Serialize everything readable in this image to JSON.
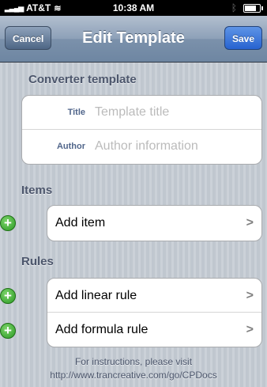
{
  "status_bar": {
    "carrier": "AT&T",
    "time": "10:38 AM",
    "battery_level": 0.8
  },
  "nav": {
    "title": "Edit Template",
    "cancel_label": "Cancel",
    "save_label": "Save"
  },
  "converter_section": {
    "header": "Converter template",
    "fields": [
      {
        "label": "Title",
        "value": "",
        "placeholder": "Template title"
      },
      {
        "label": "Author",
        "value": "",
        "placeholder": "Author information"
      }
    ]
  },
  "items_section": {
    "header": "Items",
    "rows": [
      {
        "label": "Add item"
      }
    ]
  },
  "rules_section": {
    "header": "Rules",
    "rows": [
      {
        "label": "Add linear rule"
      },
      {
        "label": "Add formula rule"
      }
    ]
  },
  "footer": {
    "line1": "For instructions, please visit",
    "line2": "http://www.trancreative.com/go/CPDocs"
  },
  "colors": {
    "background": "#c5ccd4",
    "nav_bar": "#6e86a2",
    "save_button": "#2763d0",
    "add_icon": "#2a9a23",
    "section_header": "#4c566c",
    "field_label": "#51668b"
  },
  "icons": [
    "signal-icon",
    "wifi-icon",
    "bluetooth-icon",
    "battery-icon",
    "add-icon",
    "chevron-right-icon"
  ]
}
